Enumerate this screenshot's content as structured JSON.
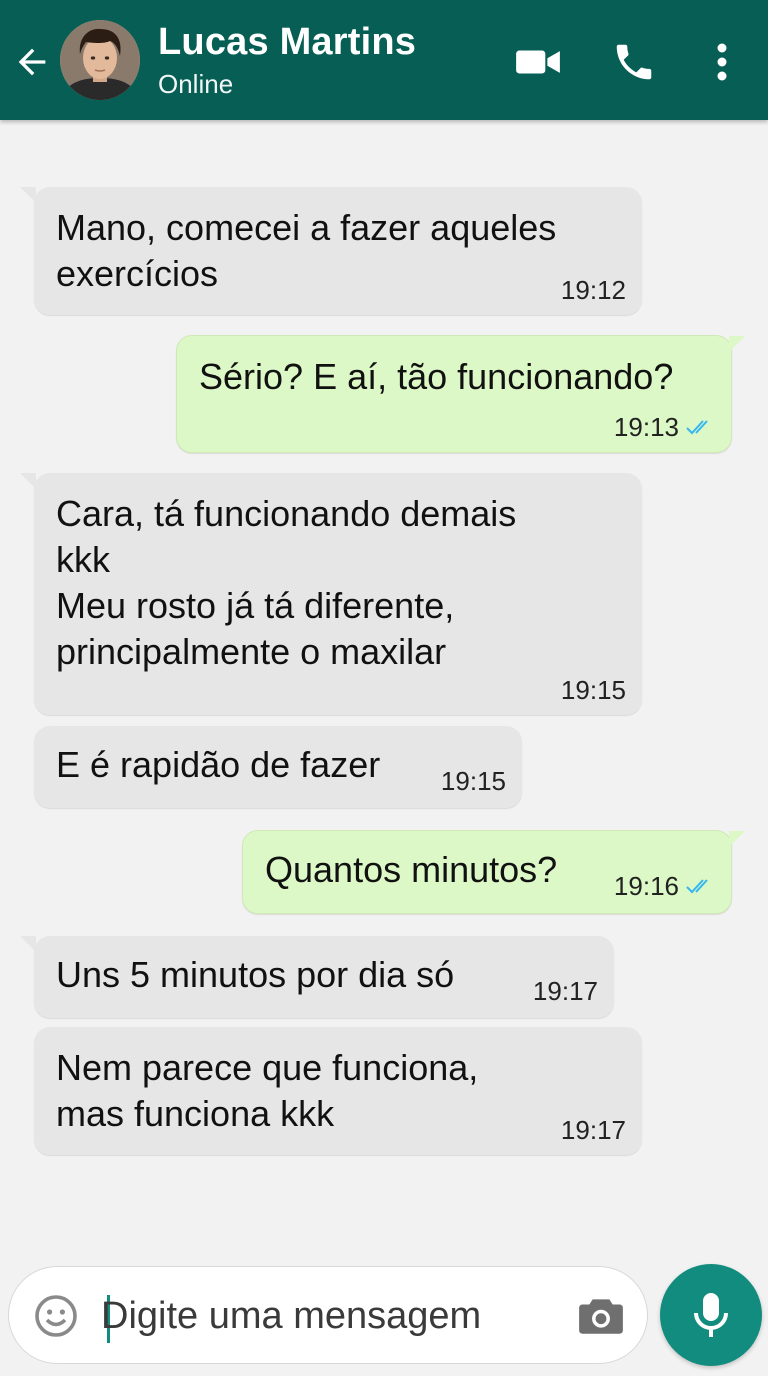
{
  "header": {
    "contact_name": "Lucas Martins",
    "status": "Online",
    "background_color": "#075e54",
    "icons": [
      "back-arrow-icon",
      "avatar",
      "video-call-icon",
      "phone-icon",
      "more-vert-icon"
    ]
  },
  "messages": [
    {
      "direction": "in",
      "text": "Mano, comecei a fazer aqueles\nexercícios",
      "time": "19:12"
    },
    {
      "direction": "out",
      "text": "Sério? E aí, tão funcionando?",
      "time": "19:13",
      "read": true
    },
    {
      "direction": "in",
      "text": "Cara, tá funcionando demais\nkkk\nMeu rosto já tá diferente,\nprincipalmente o maxilar",
      "time": "19:15"
    },
    {
      "direction": "in",
      "text": "E é rapidão de fazer",
      "time": "19:15"
    },
    {
      "direction": "out",
      "text": "Quantos minutos?",
      "time": "19:16",
      "read": true
    },
    {
      "direction": "in",
      "text": "Uns 5 minutos por dia só",
      "time": "19:17"
    },
    {
      "direction": "in",
      "text": "Nem parece que funciona,\nmas funciona kkk",
      "time": "19:17"
    }
  ],
  "composer": {
    "placeholder": "Digite uma mensagem",
    "icons": [
      "emoji-icon",
      "camera-icon",
      "mic-icon"
    ],
    "accent_color": "#128c7e"
  },
  "colors": {
    "incoming_bubble": "#e6e6e6",
    "outgoing_bubble": "#dcf8c6",
    "read_ticks": "#34b7f1",
    "chat_background": "#f2f2f2"
  }
}
